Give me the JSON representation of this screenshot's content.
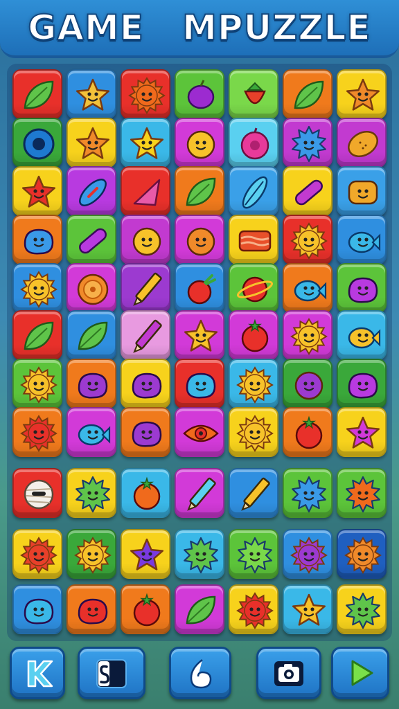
{
  "header": {
    "title": "GAME   MPUZZLE"
  },
  "board": {
    "rows": [
      [
        {
          "icon": "leaf-icon",
          "bg": "#e8302a",
          "fg": "#5fc44a"
        },
        {
          "icon": "star-icon",
          "bg": "#2f8fe0",
          "fg": "#f2c23a"
        },
        {
          "icon": "sun-icon",
          "bg": "#e8302a",
          "fg": "#f06a1c"
        },
        {
          "icon": "plum-icon",
          "bg": "#5cc43a",
          "fg": "#9c2bd0"
        },
        {
          "icon": "strawberry-icon",
          "bg": "#7ad84a",
          "fg": "#e8402a"
        },
        {
          "icon": "leaf-icon",
          "bg": "#f07a1c",
          "fg": "#5fc44a"
        },
        {
          "icon": "star-icon",
          "bg": "#f7d21c",
          "fg": "#f08a2a"
        }
      ],
      [
        {
          "icon": "ring-icon",
          "bg": "#3aa83a",
          "fg": "#1e7ad0"
        },
        {
          "icon": "star-icon",
          "bg": "#f7d21c",
          "fg": "#f08a2a"
        },
        {
          "icon": "star-icon",
          "bg": "#3ab8e8",
          "fg": "#f7d21c"
        },
        {
          "icon": "smiley-icon",
          "bg": "#d23ad8",
          "fg": "#f7c22a"
        },
        {
          "icon": "donut-icon",
          "bg": "#5ad0f0",
          "fg": "#e83a9a"
        },
        {
          "icon": "spiky-icon",
          "bg": "#c23ad0",
          "fg": "#3a9ae8"
        },
        {
          "icon": "lemon-icon",
          "bg": "#c23ad0",
          "fg": "#f0a82a"
        }
      ],
      [
        {
          "icon": "star-icon",
          "bg": "#f7d21c",
          "fg": "#e8302a"
        },
        {
          "icon": "candy-icon",
          "bg": "#b83ae0",
          "fg": "#3a9ae8"
        },
        {
          "icon": "triangle-icon",
          "bg": "#e8302a",
          "fg": "#e85aa8"
        },
        {
          "icon": "leaf-icon",
          "bg": "#f07a1c",
          "fg": "#5fc44a"
        },
        {
          "icon": "feather-icon",
          "bg": "#3aa0e8",
          "fg": "#5ad0f0"
        },
        {
          "icon": "capsule-icon",
          "bg": "#f7d21c",
          "fg": "#c23ad0"
        },
        {
          "icon": "square-face-icon",
          "bg": "#3aa0e8",
          "fg": "#f0a82a"
        }
      ],
      [
        {
          "icon": "blob-icon",
          "bg": "#f07a1c",
          "fg": "#3a9ae8"
        },
        {
          "icon": "capsule-icon",
          "bg": "#5cc43a",
          "fg": "#b83ae0"
        },
        {
          "icon": "smiley-icon",
          "bg": "#c23ad0",
          "fg": "#f7c22a"
        },
        {
          "icon": "smiley-icon",
          "bg": "#d23ad8",
          "fg": "#f08a2a"
        },
        {
          "icon": "bacon-icon",
          "bg": "#f7d21c",
          "fg": "#e8502a"
        },
        {
          "icon": "sun-icon",
          "bg": "#e8302a",
          "fg": "#f7c22a"
        },
        {
          "icon": "fish-icon",
          "bg": "#2f8fe0",
          "fg": "#3ab8e8"
        }
      ],
      [
        {
          "icon": "sun-icon",
          "bg": "#2f8fe0",
          "fg": "#f7c22a"
        },
        {
          "icon": "orange-slice-icon",
          "bg": "#d23ad8",
          "fg": "#f08a2a"
        },
        {
          "icon": "pencil-icon",
          "bg": "#9c3ad0",
          "fg": "#f7c22a"
        },
        {
          "icon": "radish-icon",
          "bg": "#2f8fe0",
          "fg": "#e8302a"
        },
        {
          "icon": "planet-icon",
          "bg": "#5cc43a",
          "fg": "#e8302a"
        },
        {
          "icon": "fish-icon",
          "bg": "#f07a1c",
          "fg": "#3ab8e8"
        },
        {
          "icon": "blob-icon",
          "bg": "#5cc43a",
          "fg": "#b83ae0"
        }
      ],
      [
        {
          "icon": "leaf-icon",
          "bg": "#e8302a",
          "fg": "#5fc44a"
        },
        {
          "icon": "leaf-icon",
          "bg": "#2f8fe0",
          "fg": "#5fc44a"
        },
        {
          "icon": "pencil-icon",
          "bg": "#e89ae0",
          "fg": "#c23ad0"
        },
        {
          "icon": "star-icon",
          "bg": "#d23ad8",
          "fg": "#f7c22a"
        },
        {
          "icon": "tomato-icon",
          "bg": "#d23ad8",
          "fg": "#e8302a"
        },
        {
          "icon": "sun-icon",
          "bg": "#d23ad8",
          "fg": "#f7c22a"
        },
        {
          "icon": "fish-icon",
          "bg": "#3ab8e8",
          "fg": "#f7c22a"
        }
      ],
      [
        {
          "icon": "sun-icon",
          "bg": "#5cc43a",
          "fg": "#f7c22a"
        },
        {
          "icon": "blob-icon",
          "bg": "#f07a1c",
          "fg": "#9c3ad0"
        },
        {
          "icon": "blob-icon",
          "bg": "#f7d21c",
          "fg": "#9c3ad0"
        },
        {
          "icon": "blob-icon",
          "bg": "#e8302a",
          "fg": "#3ab8e8"
        },
        {
          "icon": "sun-icon",
          "bg": "#3ab8e8",
          "fg": "#f7c22a"
        },
        {
          "icon": "smiley-icon",
          "bg": "#3aa83a",
          "fg": "#9c3ad0"
        },
        {
          "icon": "blob-icon",
          "bg": "#3aa83a",
          "fg": "#b83ae0"
        }
      ],
      [
        {
          "icon": "sun-icon",
          "bg": "#f07a1c",
          "fg": "#e8302a"
        },
        {
          "icon": "fish-icon",
          "bg": "#d23ad8",
          "fg": "#3ab8e8"
        },
        {
          "icon": "blob-icon",
          "bg": "#f07a1c",
          "fg": "#9c3ad0"
        },
        {
          "icon": "eye-icon",
          "bg": "#d23ad8",
          "fg": "#f06a1c"
        },
        {
          "icon": "sun-icon",
          "bg": "#f7d21c",
          "fg": "#f7c22a"
        },
        {
          "icon": "tomato-icon",
          "bg": "#f07a1c",
          "fg": "#e8302a"
        },
        {
          "icon": "star-icon",
          "bg": "#f7d21c",
          "fg": "#d23ad8"
        }
      ],
      [
        {
          "icon": "mummy-icon",
          "bg": "#e8302a",
          "fg": "#f4f0ea"
        },
        {
          "icon": "spiky-icon",
          "bg": "#f7d21c",
          "fg": "#5fc44a"
        },
        {
          "icon": "tomato-icon",
          "bg": "#3ab8e8",
          "fg": "#f06a1c"
        },
        {
          "icon": "pencil-icon",
          "bg": "#d23ad8",
          "fg": "#5ad0f0"
        },
        {
          "icon": "pencil-icon",
          "bg": "#2f8fe0",
          "fg": "#f7c22a"
        },
        {
          "icon": "spiky-icon",
          "bg": "#5cc43a",
          "fg": "#3a9ae8"
        },
        {
          "icon": "spiky-icon",
          "bg": "#5cc43a",
          "fg": "#f06a1c"
        }
      ],
      [
        {
          "icon": "sun-icon",
          "bg": "#f7d21c",
          "fg": "#e8402a"
        },
        {
          "icon": "sun-icon",
          "bg": "#3aa83a",
          "fg": "#f7c22a"
        },
        {
          "icon": "star-icon",
          "bg": "#f7d21c",
          "fg": "#7a3ae0"
        },
        {
          "icon": "spiky-icon",
          "bg": "#3ab8e8",
          "fg": "#5fc44a"
        },
        {
          "icon": "spiky-icon",
          "bg": "#5cc43a",
          "fg": "#7ad84a"
        },
        {
          "icon": "sun-icon",
          "bg": "#2f8fe0",
          "fg": "#9c3ad0"
        },
        {
          "icon": "sun-icon",
          "bg": "#1f5fc0",
          "fg": "#f08a2a"
        }
      ],
      [
        {
          "icon": "blob-icon",
          "bg": "#2f8fe0",
          "fg": "#3ab8e8"
        },
        {
          "icon": "blob-icon",
          "bg": "#f07a1c",
          "fg": "#e8302a"
        },
        {
          "icon": "tomato-icon",
          "bg": "#f07a1c",
          "fg": "#e8302a"
        },
        {
          "icon": "leaf-icon",
          "bg": "#d23ad8",
          "fg": "#5fc44a"
        },
        {
          "icon": "sun-icon",
          "bg": "#f7d21c",
          "fg": "#e8302a"
        },
        {
          "icon": "star-icon",
          "bg": "#3ab8e8",
          "fg": "#f7c22a"
        },
        {
          "icon": "spiky-icon",
          "bg": "#f7d21c",
          "fg": "#5fc44a"
        }
      ]
    ]
  },
  "toolbar": {
    "buttons": [
      {
        "name": "k-button",
        "icon": "k-icon"
      },
      {
        "name": "s-button",
        "icon": "s-icon"
      },
      {
        "name": "hint-button",
        "icon": "hint-icon"
      },
      {
        "name": "camera-button",
        "icon": "camera-icon"
      },
      {
        "name": "play-button",
        "icon": "play-icon"
      }
    ]
  }
}
